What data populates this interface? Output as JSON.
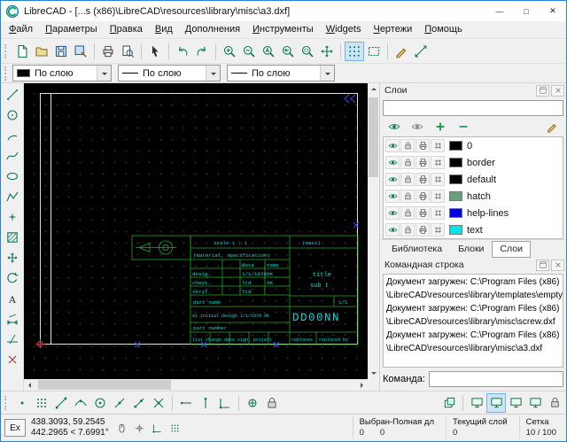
{
  "window": {
    "title": "LibreCAD - [...s (x86)\\LibreCAD\\resources\\library\\misc\\a3.dxf]",
    "controls": {
      "minimize": "—",
      "maximize": "□",
      "close": "✕"
    }
  },
  "menubar": {
    "items": [
      "Файл",
      "Параметры",
      "Правка",
      "Вид",
      "Дополнения",
      "Инструменты",
      "Widgets",
      "Чертежи",
      "Помощь"
    ]
  },
  "toolbars": {
    "main": [
      {
        "name": "new-document",
        "icon": "doc"
      },
      {
        "name": "open-file",
        "icon": "folder"
      },
      {
        "name": "save",
        "icon": "save"
      },
      {
        "name": "save-as",
        "icon": "saveas"
      },
      {
        "sep": true
      },
      {
        "name": "print",
        "icon": "print"
      },
      {
        "name": "print-preview",
        "icon": "preview"
      },
      {
        "sep": true
      },
      {
        "name": "select-pointer",
        "icon": "pointer"
      },
      {
        "sep": true
      },
      {
        "name": "undo",
        "icon": "undo"
      },
      {
        "name": "redo",
        "icon": "redo"
      },
      {
        "sep": true
      },
      {
        "name": "zoom-in",
        "icon": "zoomin"
      },
      {
        "name": "zoom-out",
        "icon": "zoomout"
      },
      {
        "name": "zoom-auto",
        "icon": "zoomauto"
      },
      {
        "name": "zoom-previous",
        "icon": "zoomprev"
      },
      {
        "name": "zoom-window",
        "icon": "zoomwin"
      },
      {
        "name": "zoom-pan",
        "icon": "pan"
      },
      {
        "sep": true
      },
      {
        "name": "grid-toggle",
        "icon": "grid",
        "pressed": true
      },
      {
        "name": "draft-mode",
        "icon": "draft"
      },
      {
        "sep": true
      },
      {
        "name": "edit-attributes",
        "icon": "attrs"
      },
      {
        "name": "measure-distance",
        "icon": "mdist"
      }
    ],
    "left": [
      {
        "name": "draw-line",
        "icon": "line"
      },
      {
        "name": "draw-circle",
        "icon": "circle"
      },
      {
        "name": "draw-arc",
        "icon": "arc"
      },
      {
        "name": "draw-spline",
        "icon": "spline"
      },
      {
        "name": "draw-ellipse",
        "icon": "ellipse"
      },
      {
        "name": "draw-polyline",
        "icon": "polyline"
      },
      {
        "name": "draw-point",
        "icon": "point"
      },
      {
        "name": "draw-hatch",
        "icon": "hatch"
      },
      {
        "name": "modify-move",
        "icon": "move"
      },
      {
        "name": "modify-rotate",
        "icon": "rotate"
      },
      {
        "name": "draw-text",
        "icon": "text"
      },
      {
        "name": "draw-dimension",
        "icon": "dim"
      },
      {
        "name": "modify-trim",
        "icon": "trim"
      },
      {
        "name": "modify-delete",
        "icon": "del"
      }
    ],
    "snap": [
      {
        "name": "snap-free",
        "icon": "snapfree"
      },
      {
        "name": "snap-grid",
        "icon": "snapgrid"
      },
      {
        "name": "snap-endpoint",
        "icon": "snapend"
      },
      {
        "name": "snap-on-entity",
        "icon": "snapentity"
      },
      {
        "name": "snap-center",
        "icon": "snapcenter"
      },
      {
        "name": "snap-middle",
        "icon": "snapmiddle"
      },
      {
        "name": "snap-distance",
        "icon": "snapdist"
      },
      {
        "name": "snap-intersection",
        "icon": "snapint"
      },
      {
        "sep": true
      },
      {
        "name": "restrict-horizontal",
        "icon": "resth"
      },
      {
        "name": "restrict-vertical",
        "icon": "restv"
      },
      {
        "name": "restrict-orthogonal",
        "icon": "resto"
      },
      {
        "sep": true
      },
      {
        "name": "set-relative-zero",
        "icon": "relzero"
      },
      {
        "name": "lock-relative-zero",
        "icon": "lock"
      }
    ],
    "view": [
      {
        "name": "draw-order",
        "icon": "order"
      },
      {
        "sep": true
      },
      {
        "name": "view-window-1",
        "icon": "monitor"
      },
      {
        "name": "view-window-2",
        "icon": "monitor",
        "pressed": true
      },
      {
        "name": "view-window-3",
        "icon": "monitor"
      },
      {
        "name": "view-window-4",
        "icon": "monitor"
      },
      {
        "name": "view-lock",
        "icon": "lock"
      }
    ],
    "status_icons": [
      {
        "name": "mouse-indicator",
        "icon": "mouse"
      },
      {
        "name": "snap-indicator",
        "icon": "crosshair"
      },
      {
        "name": "ortho-indicator",
        "icon": "resto"
      },
      {
        "name": "grid-indicator",
        "icon": "snapgrid"
      }
    ]
  },
  "pen_toolbar": {
    "color_label": "По слою",
    "width_label": "По слою",
    "linetype_label": "По слою"
  },
  "layers": {
    "title": "Слои",
    "filter_value": "",
    "toolbar": [
      {
        "name": "show-all-layers",
        "icon": "eye"
      },
      {
        "name": "hide-all-layers",
        "icon": "eyeoff"
      },
      {
        "name": "add-layer",
        "icon": "plus"
      },
      {
        "name": "remove-layer",
        "icon": "minus"
      },
      {
        "name": "edit-layer",
        "icon": "attrs"
      }
    ],
    "items": [
      {
        "name": "0",
        "color": "#000000"
      },
      {
        "name": "border",
        "color": "#000000"
      },
      {
        "name": "default",
        "color": "#000000"
      },
      {
        "name": "hatch",
        "color": "#69a07a"
      },
      {
        "name": "help-lines",
        "color": "#0000e0"
      },
      {
        "name": "text",
        "color": "#00e5e5"
      }
    ]
  },
  "dock_tabs": {
    "items": [
      {
        "label": "Библиотека",
        "active": false
      },
      {
        "label": "Блоки",
        "active": false
      },
      {
        "label": "Слои",
        "active": true
      }
    ]
  },
  "command": {
    "title": "Командная строка",
    "lines": [
      "Документ загружен: C:\\Program Files (x86)",
      "\\LibreCAD\\resources\\library\\templates\\empty.dxf",
      "Документ загружен: C:\\Program Files (x86)",
      "\\LibreCAD\\resources\\library\\misc\\screw.dxf",
      "Документ загружен: C:\\Program Files (x86)",
      "\\LibreCAD\\resources\\library\\misc\\a3.dxf"
    ],
    "prompt_label": "Команда:",
    "input_value": ""
  },
  "statusbar": {
    "ex_label": "Ex",
    "abs_coord": "438.3093, 59.2545",
    "rel_coord": "442.2965 < 7.6991°",
    "selection_label": "Выбран-Полная дл",
    "selection_count": "0",
    "selection_length": "0",
    "layer_label": "Текущий слой",
    "layer_value": "0",
    "grid_label": "Сетка",
    "grid_value": "10 / 100"
  },
  "drawing": {
    "colors": {
      "frame": "#cfe6cf",
      "block_lines": "#2aa52a",
      "text": "#00dcdc",
      "markers": "#4646ff"
    },
    "title_block": {
      "scale": "scale  1 : 1",
      "mass": "(mass)",
      "material": "(material, specification)",
      "col_date": "date",
      "col_name": "name",
      "r1_label": "desig.",
      "r1_date": "1/1/1970",
      "r1_name": "OK",
      "r2_label": "check.",
      "r2_date": "ltd",
      "r2_name": "OK",
      "r3_label": "verif.",
      "r3_date": "ltd",
      "part_name": "part name",
      "title": "title",
      "subtitle": "sub t",
      "number": "DD00NN",
      "sheet": "1/1",
      "part_number": "part number",
      "rev_row": "A1  initial design  1/1/1970  OK",
      "footer_row": "list  change  date  sign.  project",
      "replaces": "replaces",
      "replaced_by": "replaced by"
    }
  }
}
